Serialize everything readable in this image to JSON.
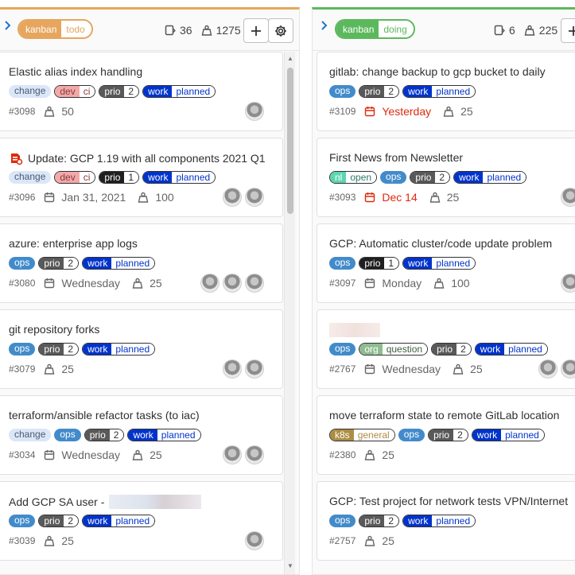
{
  "columns": [
    {
      "label_key": "kanban",
      "label_value": "todo",
      "issue_count": "36",
      "weight_total": "1275",
      "cards": [
        {
          "title": "Elastic alias index handling",
          "labels": [
            {
              "t": "change"
            },
            {
              "k": "dev",
              "v": "ci"
            },
            {
              "k": "prio",
              "v": "2"
            },
            {
              "k": "work",
              "v": "planned"
            }
          ],
          "ref": "#3098",
          "date": "",
          "weight": "50",
          "avatars": 1
        },
        {
          "title": "Update: GCP 1.19 with all components 2021 Q1",
          "bug": true,
          "labels": [
            {
              "t": "change"
            },
            {
              "k": "dev",
              "v": "ci"
            },
            {
              "k": "prio",
              "v": "1"
            },
            {
              "k": "work",
              "v": "planned"
            }
          ],
          "ref": "#3096",
          "date": "Jan 31, 2021",
          "weight": "100",
          "avatars": 2
        },
        {
          "title": "azure: enterprise app logs",
          "labels": [
            {
              "t": "ops"
            },
            {
              "k": "prio",
              "v": "2"
            },
            {
              "k": "work",
              "v": "planned"
            }
          ],
          "ref": "#3080",
          "date": "Wednesday",
          "weight": "25",
          "avatars": 3
        },
        {
          "title": "git repository forks",
          "labels": [
            {
              "t": "ops"
            },
            {
              "k": "prio",
              "v": "2"
            },
            {
              "k": "work",
              "v": "planned"
            }
          ],
          "ref": "#3079",
          "date": "",
          "weight": "25",
          "avatars": 2
        },
        {
          "title": "terraform/ansible refactor tasks (to iac)",
          "labels": [
            {
              "t": "change"
            },
            {
              "t": "ops"
            },
            {
              "k": "prio",
              "v": "2"
            },
            {
              "k": "work",
              "v": "planned"
            }
          ],
          "ref": "#3034",
          "date": "Wednesday",
          "weight": "25",
          "avatars": 2
        },
        {
          "title": "Add GCP SA user -",
          "redacted": true,
          "labels": [
            {
              "t": "ops"
            },
            {
              "k": "prio",
              "v": "2"
            },
            {
              "k": "work",
              "v": "planned"
            }
          ],
          "ref": "#3039",
          "date": "",
          "weight": "25",
          "avatars": 1
        }
      ]
    },
    {
      "label_key": "kanban",
      "label_value": "doing",
      "issue_count": "6",
      "weight_total": "225",
      "cards": [
        {
          "title": "gitlab: change backup to gcp bucket to daily",
          "labels": [
            {
              "t": "ops"
            },
            {
              "k": "prio",
              "v": "2"
            },
            {
              "k": "work",
              "v": "planned"
            }
          ],
          "ref": "#3109",
          "date": "Yesterday",
          "date_overdue": true,
          "weight": "25",
          "avatars": 0
        },
        {
          "title": "First News from Newsletter",
          "labels": [
            {
              "k": "nl",
              "v": "open"
            },
            {
              "t": "ops"
            },
            {
              "k": "prio",
              "v": "2"
            },
            {
              "k": "work",
              "v": "planned"
            }
          ],
          "ref": "#3093",
          "date": "Dec 14",
          "date_overdue": true,
          "weight": "25",
          "avatars": 1
        },
        {
          "title": "GCP: Automatic cluster/code update problem",
          "labels": [
            {
              "t": "ops"
            },
            {
              "k": "prio",
              "v": "1"
            },
            {
              "k": "work",
              "v": "planned"
            }
          ],
          "ref": "#3097",
          "date": "Monday",
          "weight": "100",
          "avatars": 1
        },
        {
          "title": "",
          "redacted_short": true,
          "labels": [
            {
              "t": "ops"
            },
            {
              "k": "org",
              "v": "question"
            },
            {
              "k": "prio",
              "v": "2"
            },
            {
              "k": "work",
              "v": "planned"
            }
          ],
          "ref": "#2767",
          "date": "Wednesday",
          "weight": "25",
          "avatars": 2
        },
        {
          "title": "move terraform state to remote GitLab location",
          "labels": [
            {
              "k": "k8s",
              "v": "general"
            },
            {
              "t": "ops"
            },
            {
              "k": "prio",
              "v": "2"
            },
            {
              "k": "work",
              "v": "planned"
            }
          ],
          "ref": "#2380",
          "date": "",
          "weight": "25",
          "avatars": 0
        },
        {
          "title": "GCP: Test project for network tests VPN/Internet",
          "labels": [
            {
              "t": "ops"
            },
            {
              "k": "prio",
              "v": "2"
            },
            {
              "k": "work",
              "v": "planned"
            }
          ],
          "ref": "#2757",
          "date": "",
          "weight": "25",
          "avatars": 0
        }
      ]
    }
  ],
  "colors": {
    "todo": "#e6a65d",
    "doing": "#5cb85c",
    "overdue": "#dd2b0e",
    "link": "#1f75cb"
  },
  "icons": {
    "collapse": "chevron-right-icon",
    "issues": "issues-icon",
    "weight": "weight-icon",
    "add": "plus-icon",
    "settings": "gear-icon",
    "due_date": "calendar-icon",
    "bug": "bug-icon"
  }
}
